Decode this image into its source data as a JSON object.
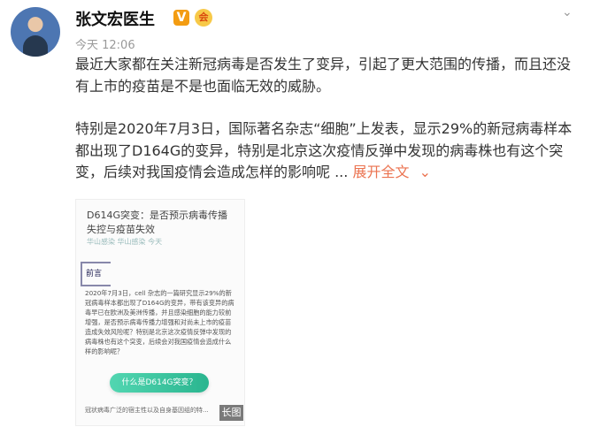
{
  "author": {
    "name": "张文宏医生",
    "verified_badge": "V",
    "member_badge": "会"
  },
  "post": {
    "time": "今天 12:06",
    "paragraph1": "最近大家都在关注新冠病毒是否发生了变异，引起了更大范围的传播，而且还没有上市的疫苗是不是也面临无效的威胁。",
    "paragraph2": "特别是2020年7月3日，国际著名杂志“细胞”上发表，显示29%的新冠病毒样本都出现了D164G的变异，特别是北京这次疫情反弹中发现的病毒株也有这个突变，后续对我国疫情会造成怎样的影响呢 ...",
    "expand": "展开全文",
    "expand_chevron": "⌄"
  },
  "thumbnail": {
    "title": "D614G突变：是否预示病毒传播失控与疫苗失效",
    "meta": "华山感染    华山感染    今天",
    "section": "前言",
    "body": "2020年7月3日，cell 杂志的一篇研究显示29%的新冠病毒样本都出现了D164G的变异，带有该变异的病毒早已在欧洲及美洲传播，并且感染细胞的能力较前增强，是否预示病毒传播力增强和对尚未上市的疫苗造成失效风险呢？特别是北京这次疫情反弹中发现的病毒株也有这个突变，后续会对我国疫情会造成什么样的影响呢？",
    "button": "什么是D614G突变？",
    "bottom": "冠状病毒广泛的宿主性以及自身基因组的特...",
    "long_label": "长图"
  },
  "colors": {
    "accent": "#eb7350",
    "button": "#2ab58f",
    "badge": "#f39c12"
  },
  "icons": {
    "menu": "chevron-down-icon"
  }
}
